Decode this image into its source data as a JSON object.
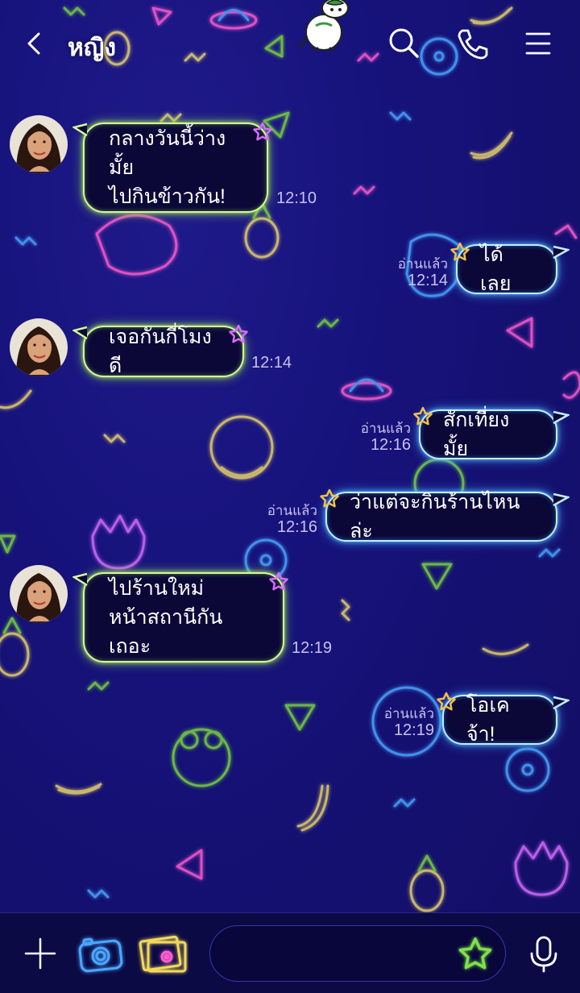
{
  "header": {
    "title": "หญิง"
  },
  "messages": [
    {
      "dir": "in",
      "lines": [
        "กลางวันนี้ว่างมั้ย",
        "ไปกินข้าวกัน!"
      ],
      "time": "12:10"
    },
    {
      "dir": "out",
      "lines": [
        "ได้เลย"
      ],
      "read": "อ่านแล้ว",
      "time": "12:14"
    },
    {
      "dir": "in",
      "lines": [
        "เจอกันกี่โมงดี"
      ],
      "time": "12:14"
    },
    {
      "dir": "out",
      "lines": [
        "สักเที่ยงมั้ย"
      ],
      "read": "อ่านแล้ว",
      "time": "12:16"
    },
    {
      "dir": "out",
      "lines": [
        "ว่าแต่จะกินร้านไหนล่ะ"
      ],
      "read": "อ่านแล้ว",
      "time": "12:16"
    },
    {
      "dir": "in",
      "lines": [
        "ไปร้านใหม่",
        "หน้าสถานีกันเถอะ"
      ],
      "time": "12:19"
    },
    {
      "dir": "out",
      "lines": [
        "โอเคจ้า!"
      ],
      "read": "อ่านแล้ว",
      "time": "12:19"
    }
  ],
  "input": {
    "placeholder": ""
  },
  "colors": {
    "background": "#14106b",
    "incoming_glow": "#a4e05c",
    "outgoing_glow": "#56b8ff",
    "incoming_star": "#d86cff",
    "outgoing_star": "#f2c04a"
  },
  "icons": {
    "header": [
      "back-icon",
      "search-icon",
      "phone-icon",
      "menu-icon"
    ],
    "bottom": [
      "plus-icon",
      "camera-icon",
      "photo-icon",
      "sticker-star-icon",
      "microphone-icon"
    ]
  }
}
